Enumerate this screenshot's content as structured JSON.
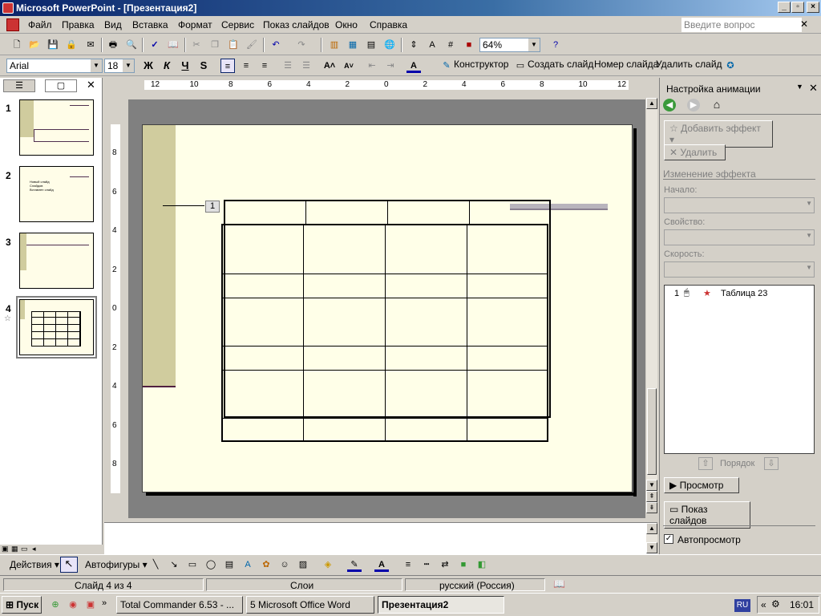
{
  "window": {
    "title": "Microsoft PowerPoint - [Презентация2]"
  },
  "menu": {
    "items": [
      "Файл",
      "Правка",
      "Вид",
      "Вставка",
      "Формат",
      "Сервис",
      "Показ слайдов",
      "Окно",
      "Справка"
    ],
    "ask_placeholder": "Введите вопрос"
  },
  "toolbar": {
    "zoom": "64%",
    "font": "Arial",
    "size": "18",
    "designer": "Конструктор",
    "new_slide": "Создать слайд",
    "slide_number": "Номер слайда",
    "delete_slide": "Удалить слайд"
  },
  "slides": {
    "numbers": [
      "1",
      "2",
      "3",
      "4"
    ],
    "thumb2_lines": [
      "Новый слайд",
      "Слайдов",
      "Вставлен слайд"
    ]
  },
  "ruler": {
    "h_labels": [
      "12",
      "10",
      "8",
      "6",
      "4",
      "2",
      "0",
      "2",
      "4",
      "6",
      "8",
      "10",
      "12"
    ],
    "v_labels": [
      "8",
      "6",
      "4",
      "2",
      "0",
      "2",
      "4",
      "6",
      "8"
    ]
  },
  "slide": {
    "anim_marker": "1"
  },
  "taskpane": {
    "title": "Настройка анимации",
    "add_effect": "Добавить эффект",
    "remove": "Удалить",
    "section": "Изменение эффекта",
    "start_label": "Начало:",
    "property_label": "Свойство:",
    "speed_label": "Скорость:",
    "list_item_num": "1",
    "list_item_name": "Таблица 23",
    "order_label": "Порядок",
    "play": "Просмотр",
    "slideshow": "Показ слайдов",
    "autopreview": "Автопросмотр"
  },
  "drawbar": {
    "actions": "Действия",
    "autoshapes": "Автофигуры"
  },
  "status": {
    "slide": "Слайд 4 из 4",
    "design": "Слои",
    "lang": "русский (Россия)"
  },
  "taskbar": {
    "start": "Пуск",
    "tasks": [
      "Total Commander 6.53 - ...",
      "5 Microsoft Office Word",
      "Презентация2"
    ],
    "lang": "RU",
    "time": "16:01"
  }
}
